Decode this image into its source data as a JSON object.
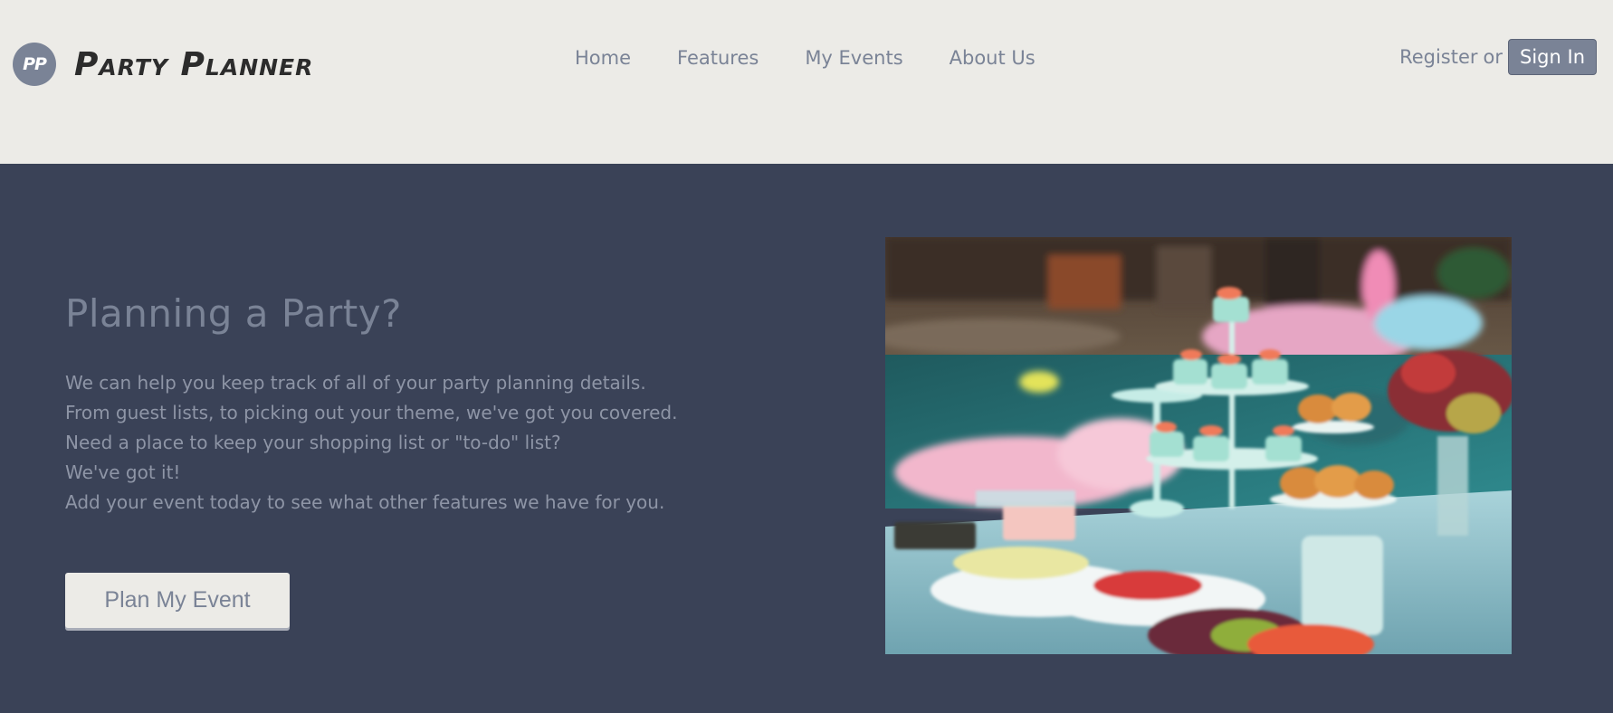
{
  "brand": {
    "logo_text": "PP",
    "name": "Party Planner"
  },
  "nav": {
    "items": [
      "Home",
      "Features",
      "My Events",
      "About Us"
    ]
  },
  "auth": {
    "register_label": "Register",
    "or_text": "or",
    "signin_label": "Sign In"
  },
  "hero": {
    "title": "Planning a Party?",
    "lines": [
      "We can help you keep track of all of your party planning details.",
      "From guest lists, to picking out your theme, we've got you covered.",
      "Need a place to keep your shopping list or \"to-do\" list?",
      "We've got it!",
      "Add your event today to see what other features we have for you."
    ],
    "cta_label": "Plan My Event"
  },
  "colors": {
    "header_bg": "#ecebe7",
    "hero_bg": "#3a4257",
    "accent": "#7a8396",
    "brand_text": "#2c2c2c"
  },
  "image": {
    "alt": "Party dessert table by a pool"
  }
}
